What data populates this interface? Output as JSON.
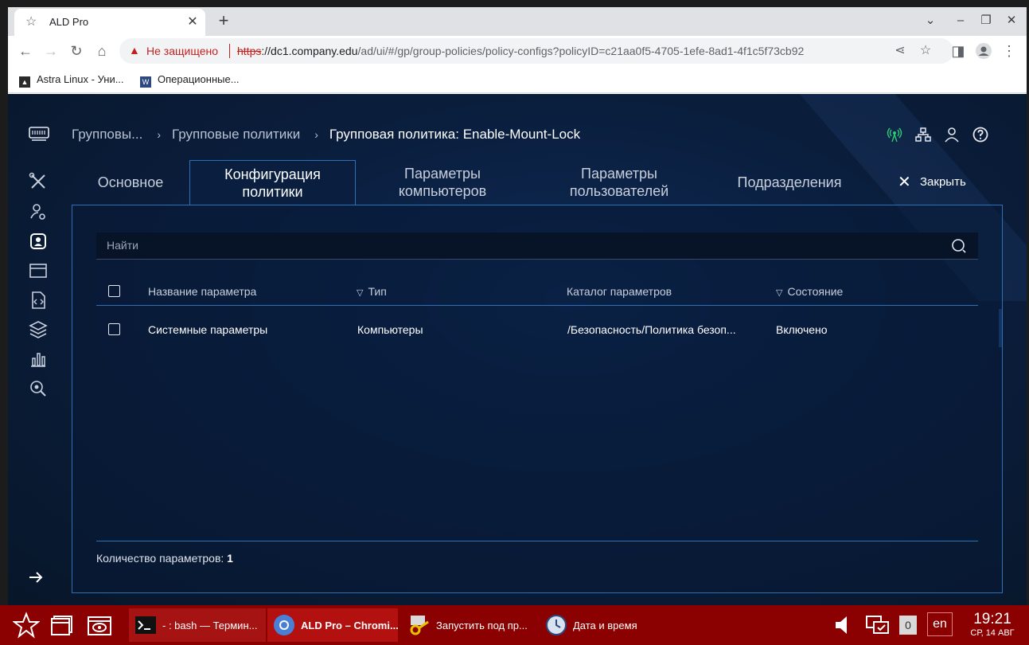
{
  "browser": {
    "tab_title": "ALD Pro",
    "not_secure": "Не защищено",
    "url_scheme": "https",
    "url_host": "://dc1.company.edu",
    "url_path": "/ad/ui/#/gp/group-policies/policy-configs?policyID=c21aa0f5-4705-1efe-8ad1-4f1c5f73cb92",
    "bookmarks": [
      {
        "label": "Astra Linux - Уни..."
      },
      {
        "label": "Операционные..."
      }
    ]
  },
  "app": {
    "breadcrumbs": [
      "Групповы...",
      "Групповые политики",
      "Групповая политика: Enable-Mount-Lock"
    ],
    "tabs": [
      {
        "label": "Основное"
      },
      {
        "label": "Конфигурация политики"
      },
      {
        "label": "Параметры компьютеров"
      },
      {
        "label": "Параметры пользователей"
      },
      {
        "label": "Подразделения"
      }
    ],
    "close_label": "Закрыть",
    "search_placeholder": "Найти",
    "table": {
      "columns": [
        "Название параметра",
        "Тип",
        "Каталог параметров",
        "Состояние"
      ],
      "rows": [
        {
          "name": "Системные параметры",
          "type": "Компьютеры",
          "catalog": "/Безопасность/Политика безоп...",
          "state": "Включено"
        }
      ]
    },
    "footer_label": "Количество параметров:",
    "footer_count": "1",
    "colors": {
      "accent": "#2f6fb5",
      "status_online": "#2ecc71"
    }
  },
  "taskbar": {
    "tasks": [
      {
        "label": "- : bash — Термин..."
      },
      {
        "label": "ALD Pro – Chromi..."
      },
      {
        "label": "Запустить под пр..."
      },
      {
        "label": "Дата и время"
      }
    ],
    "keyboard_indicator": "0",
    "language": "en",
    "time": "19:21",
    "date": "СР, 14 АВГ"
  }
}
